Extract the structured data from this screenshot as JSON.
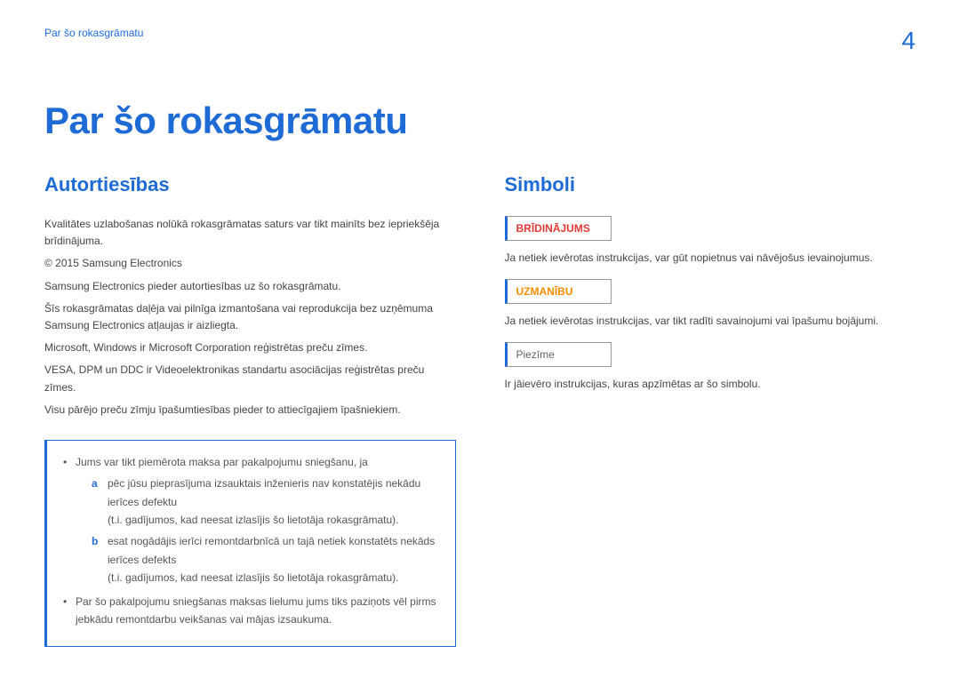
{
  "header": {
    "breadcrumb": "Par šo rokasgrāmatu",
    "page_number": "4"
  },
  "title": "Par šo rokasgrāmatu",
  "left": {
    "section_title": "Autortiesības",
    "p1": "Kvalitātes uzlabošanas nolūkā rokasgrāmatas saturs var tikt mainīts bez iepriekšēja brīdinājuma.",
    "p2": "© 2015 Samsung Electronics",
    "p3": "Samsung Electronics pieder autortiesības uz šo rokasgrāmatu.",
    "p4": "Šīs rokasgrāmatas daļēja vai pilnīga izmantošana vai reprodukcija bez uzņēmuma Samsung Electronics atļaujas ir aizliegta.",
    "p5": "Microsoft, Windows ir Microsoft Corporation reģistrētas preču zīmes.",
    "p6": "VESA, DPM un DDC ir Videoelektronikas standartu asociācijas reģistrētas preču zīmes.",
    "p7": "Visu pārējo preču zīmju īpašumtiesības pieder to attiecīgajiem īpašniekiem.",
    "box": {
      "b1": "Jums var tikt piemērota maksa par pakalpojumu sniegšanu, ja",
      "a_letter": "a",
      "a_text": "pēc jūsu pieprasījuma izsauktais inženieris nav konstatējis nekādu ierīces defektu",
      "a_sub": "(t.i. gadījumos, kad neesat izlasījis šo lietotāja rokasgrāmatu).",
      "b_letter": "b",
      "b_text": "esat nogādājis ierīci remontdarbnīcā un tajā netiek konstatēts nekāds ierīces defekts",
      "b_sub": "(t.i. gadījumos, kad neesat izlasījis šo lietotāja rokasgrāmatu).",
      "b2": "Par šo pakalpojumu sniegšanas maksas lielumu jums tiks paziņots vēl pirms jebkādu remontdarbu veikšanas vai mājas izsaukuma."
    }
  },
  "right": {
    "section_title": "Simboli",
    "warn_label": "BRĪDINĀJUMS",
    "warn_text": "Ja netiek ievērotas instrukcijas, var gūt nopietnus vai nāvējošus ievainojumus.",
    "caution_label": "UZMANĪBU",
    "caution_text": "Ja netiek ievērotas instrukcijas, var tikt radīti savainojumi vai īpašumu bojājumi.",
    "note_label": "Piezīme",
    "note_text": "Ir jāievēro instrukcijas, kuras apzīmētas ar šo simbolu."
  }
}
